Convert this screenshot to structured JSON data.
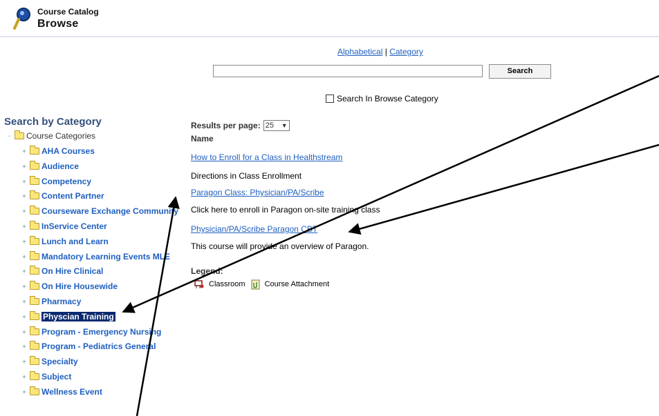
{
  "header": {
    "small_title": "Course Catalog",
    "big_title": "Browse",
    "icon": "magnifier-icon"
  },
  "search": {
    "mode_alphabetical": "Alphabetical",
    "mode_separator": "|",
    "mode_category": "Category",
    "input_value": "",
    "button_label": "Search",
    "browse_checkbox_label": "Search In Browse Category",
    "browse_checkbox_checked": false
  },
  "sidebar": {
    "heading": "Search by Category",
    "root": {
      "label": "Course Categories",
      "expander": "−"
    },
    "items": [
      {
        "label": "AHA Courses"
      },
      {
        "label": "Audience"
      },
      {
        "label": "Competency"
      },
      {
        "label": "Content Partner"
      },
      {
        "label": "Courseware Exchange Community"
      },
      {
        "label": "InService Center"
      },
      {
        "label": "Lunch and Learn"
      },
      {
        "label": "Mandatory Learning Events MLE"
      },
      {
        "label": "On Hire Clinical"
      },
      {
        "label": "On Hire Housewide"
      },
      {
        "label": "Pharmacy"
      },
      {
        "label": "Physcian Training",
        "selected": true
      },
      {
        "label": "Program - Emergency Nursing"
      },
      {
        "label": "Program - Pediatrics General"
      },
      {
        "label": "Specialty"
      },
      {
        "label": "Subject"
      },
      {
        "label": "Wellness Event"
      }
    ],
    "expander": "+"
  },
  "results": {
    "per_page_label": "Results per page:",
    "per_page_value": "25",
    "column_name": "Name",
    "rows": [
      {
        "title": "How to Enroll for a Class in Healthstream",
        "description": "Directions in Class Enrollment"
      },
      {
        "title": "Paragon Class: Physician/PA/Scribe",
        "description": "Click here to enroll in Paragon on-site training class"
      },
      {
        "title": "Physician/PA/Scribe Paragon CBT",
        "description": "This course will provide an overview of Paragon."
      }
    ]
  },
  "legend": {
    "title": "Legend:",
    "classroom_label": "Classroom",
    "attachment_label": "Course Attachment",
    "classroom_icon": "classroom-icon",
    "attachment_icon": "attachment-icon"
  },
  "colors": {
    "link": "#1f5fbf",
    "heading": "#33507a",
    "selected_bg": "#0b2a6e",
    "folder": "#fbe67a"
  }
}
